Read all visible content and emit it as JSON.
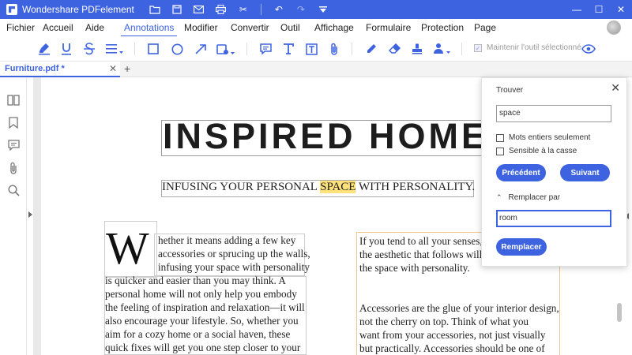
{
  "window": {
    "app_title": "Wondershare PDFelement",
    "controls": [
      "minimize",
      "maximize",
      "close"
    ]
  },
  "menu": {
    "items": [
      "Fichier",
      "Accueil",
      "Aide",
      "Annotations",
      "Modifier",
      "Convertir",
      "Outil",
      "Affichage",
      "Formulaire",
      "Protection",
      "Page"
    ],
    "active": "Annotations"
  },
  "toolbar": {
    "keep_tool_label": "Maintenir l'outil sélectionné",
    "keep_tool_checked": true
  },
  "tabs": {
    "file_tab_label": "Furniture.pdf *"
  },
  "document": {
    "heading": "INSPIRED HOME",
    "subtitle_before": "INFUSING YOUR PERSONAL ",
    "subtitle_highlight": "SPACE",
    "subtitle_after": " WITH PERSONALITY.",
    "dropcap": "W",
    "col1_lines": [
      "hether it means adding a few key",
      "accessories or sprucing up the walls,",
      "infusing your space with personality",
      "is quicker and easier than you may think. A",
      "personal home will not only help you embody",
      "the feeling of inspiration and relaxation—it will",
      "also encourage your lifestyle. So, whether you",
      "aim for a cozy home or a social haven, these",
      "quick fixes will get you one step closer to your"
    ],
    "col2_lines": [
      "If you tend to all your senses, yo",
      "the aesthetic that follows will na",
      "the space with personality.",
      "",
      "Accessories are the glue of your interior design,",
      "not the cherry on top. Think of what you",
      "want from your accessories, not just visually",
      "but practically. Accessories should be one of"
    ]
  },
  "find_panel": {
    "title": "Trouver",
    "search_value": "space",
    "option_whole_words": "Mots entiers seulement",
    "option_match_case": "Sensible à la casse",
    "prev_button": "Précédent",
    "next_button": "Suivant",
    "replace_toggle": "Remplacer par",
    "replace_value": "room",
    "replace_button": "Remplacer"
  },
  "colors": {
    "accent": "#3d63e0",
    "highlight": "#ffe27a"
  }
}
